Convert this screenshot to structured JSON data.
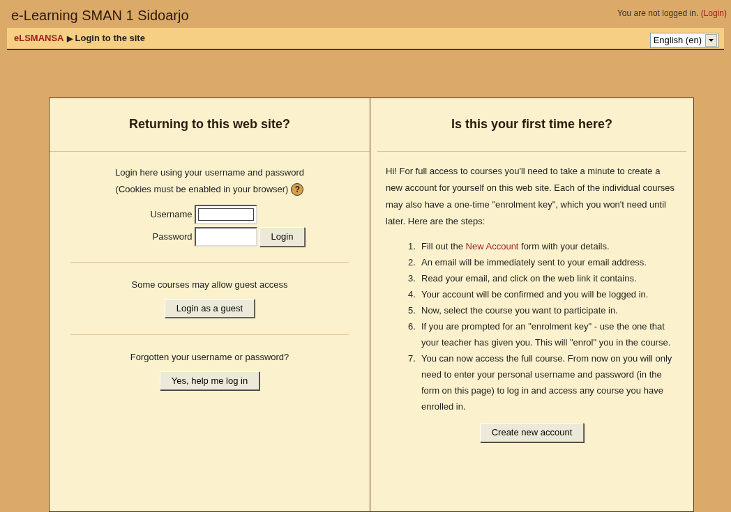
{
  "header": {
    "site_title": "e-Learning SMAN 1 Sidoarjo",
    "login_status": "You are not logged in.",
    "login_link": "(Login)"
  },
  "breadcrumb": {
    "items": [
      {
        "label": "eLSMANSA",
        "kind": "link"
      },
      {
        "label": "Login to the site",
        "kind": "current"
      }
    ],
    "separator": "▶"
  },
  "language_select": {
    "value": "English (en)"
  },
  "login_panel": {
    "title": "Returning to this web site?",
    "intro": "Login here using your username and password",
    "cookies_note": "(Cookies must be enabled in your browser)",
    "help_icon": "?",
    "fields": [
      {
        "label": "Username",
        "focused": true
      },
      {
        "label": "Password",
        "focused": false
      }
    ],
    "login_button": "Login",
    "guest_text": "Some courses may allow guest access",
    "guest_button": "Login as a guest",
    "forgot_text": "Forgotten your username or password?",
    "forgot_button": "Yes, help me log in"
  },
  "signup_panel": {
    "title": "Is this your first time here?",
    "intro": "Hi! For full access to courses you'll need to take a minute to create a new account for yourself on this web site. Each of the individual courses may also have a one-time \"enrolment key\", which you won't need until later. Here are the steps:",
    "steps": [
      {
        "number": "1.",
        "parts": [
          {
            "text": "Fill out the ",
            "kind": "text"
          },
          {
            "text": "New Account",
            "kind": "link"
          },
          {
            "text": " form with your details.",
            "kind": "text"
          }
        ]
      },
      {
        "number": "2.",
        "parts": [
          {
            "text": "An email will be immediately sent to your email address.",
            "kind": "text"
          }
        ]
      },
      {
        "number": "3.",
        "parts": [
          {
            "text": "Read your email, and click on the web link it contains.",
            "kind": "text"
          }
        ]
      },
      {
        "number": "4.",
        "parts": [
          {
            "text": "Your account will be confirmed and you will be logged in.",
            "kind": "text"
          }
        ]
      },
      {
        "number": "5.",
        "parts": [
          {
            "text": "Now, select the course you want to participate in.",
            "kind": "text"
          }
        ]
      },
      {
        "number": "6.",
        "parts": [
          {
            "text": "If you are prompted for an \"enrolment key\" - use the one that your teacher has given you. This will \"enrol\" you in the course.",
            "kind": "text"
          }
        ]
      },
      {
        "number": "7.",
        "parts": [
          {
            "text": "You can now access the full course. From now on you will only need to enter your personal username and password (in the form on this page) to log in and access any course you have enrolled in.",
            "kind": "text"
          }
        ]
      }
    ],
    "create_button": "Create new account"
  }
}
